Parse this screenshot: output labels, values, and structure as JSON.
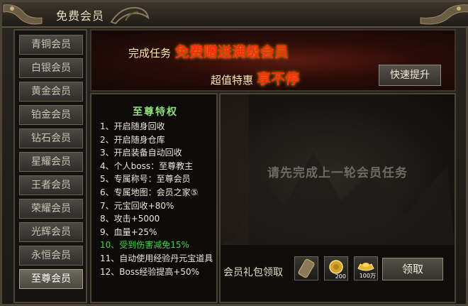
{
  "window": {
    "title": "免费会员"
  },
  "sidebar": {
    "items": [
      {
        "label": "青铜会员"
      },
      {
        "label": "白银会员"
      },
      {
        "label": "黄金会员"
      },
      {
        "label": "铂金会员"
      },
      {
        "label": "钻石会员"
      },
      {
        "label": "星耀会员"
      },
      {
        "label": "王者会员"
      },
      {
        "label": "荣耀会员"
      },
      {
        "label": "光辉会员"
      },
      {
        "label": "永恒会员"
      },
      {
        "label": "至尊会员"
      }
    ],
    "active_index": 10
  },
  "banner": {
    "line1_a": "完成任务",
    "line1_b": "免费赠送满级会员",
    "line2_a": "超值特惠",
    "line2_b": "享不停",
    "quick_button": "快速提升"
  },
  "perks": {
    "title": "至尊特权",
    "items": [
      {
        "text": "1、开启随身回收"
      },
      {
        "text": "2、开启随身仓库"
      },
      {
        "text": "3、开启装备自动回收"
      },
      {
        "text": "4、个人boss：至尊教主"
      },
      {
        "text": "5、专属称号：至尊会员"
      },
      {
        "text": "6、专属地图：会员之家⑤"
      },
      {
        "text": "7、元宝回收+80%"
      },
      {
        "text": "8、攻击+5000"
      },
      {
        "text": "9、血量+25%"
      },
      {
        "text": "10、受到伤害减免15%"
      },
      {
        "text": "11、自动使用经验丹元宝道具"
      },
      {
        "text": "12、Boss经验提高+50%"
      }
    ]
  },
  "task_panel": {
    "locked_message": "请先完成上一轮会员任务"
  },
  "gift": {
    "label": "会员礼包领取",
    "items": [
      {
        "icon": "scroll-icon",
        "count": ""
      },
      {
        "icon": "gold-coin-icon",
        "count": "200"
      },
      {
        "icon": "gold-ingot-icon",
        "count": "100万"
      }
    ],
    "claim_button": "领取"
  },
  "colors": {
    "accent_red": "#ff2a14",
    "perk_title_green": "#8fe07a",
    "highlight_green": "#3ad83a"
  }
}
